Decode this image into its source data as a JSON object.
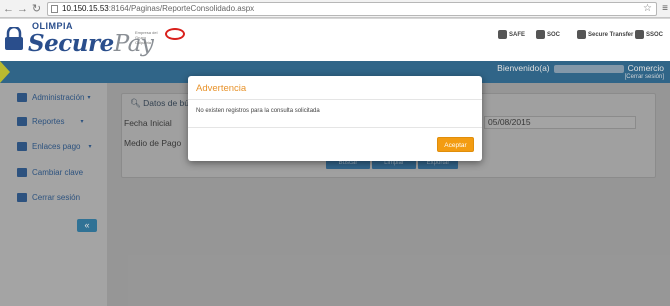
{
  "browser": {
    "url_host": "10.150.15.53",
    "url_path": ":8164/Paginas/ReporteConsolidado.aspx"
  },
  "header": {
    "brand_top": "OLIMPIA",
    "brand_main": "Secure",
    "brand_suffix": "Pay",
    "partner_text": "Empresa del Grupo Colpatria",
    "certifications": [
      "SAFE",
      "SOC",
      "Secure Transfer",
      "SSOC"
    ]
  },
  "userbar": {
    "welcome": "Bienvenido(a)",
    "company": "Comercio",
    "logout": "[Cerrar sesión]"
  },
  "sidebar": {
    "items": [
      {
        "label": "Administración",
        "caret": "▾"
      },
      {
        "label": "Reportes",
        "caret": "▾"
      },
      {
        "label": "Enlaces pago",
        "caret": "▾"
      },
      {
        "label": "Cambiar clave",
        "caret": ""
      },
      {
        "label": "Cerrar sesión",
        "caret": ""
      }
    ],
    "collapse_icon": "«"
  },
  "main": {
    "panel_title": "Datos de búsqueda",
    "fecha_inicial_label": "Fecha Inicial",
    "medio_pago_label": "Medio de Pago",
    "fecha_final_value": "05/08/2015",
    "buttons": [
      "Buscar",
      "Limpiar",
      "Exportar"
    ]
  },
  "modal": {
    "title": "Advertencia",
    "message": "No existen registros para la consulta solicitada",
    "accept": "Aceptar"
  }
}
